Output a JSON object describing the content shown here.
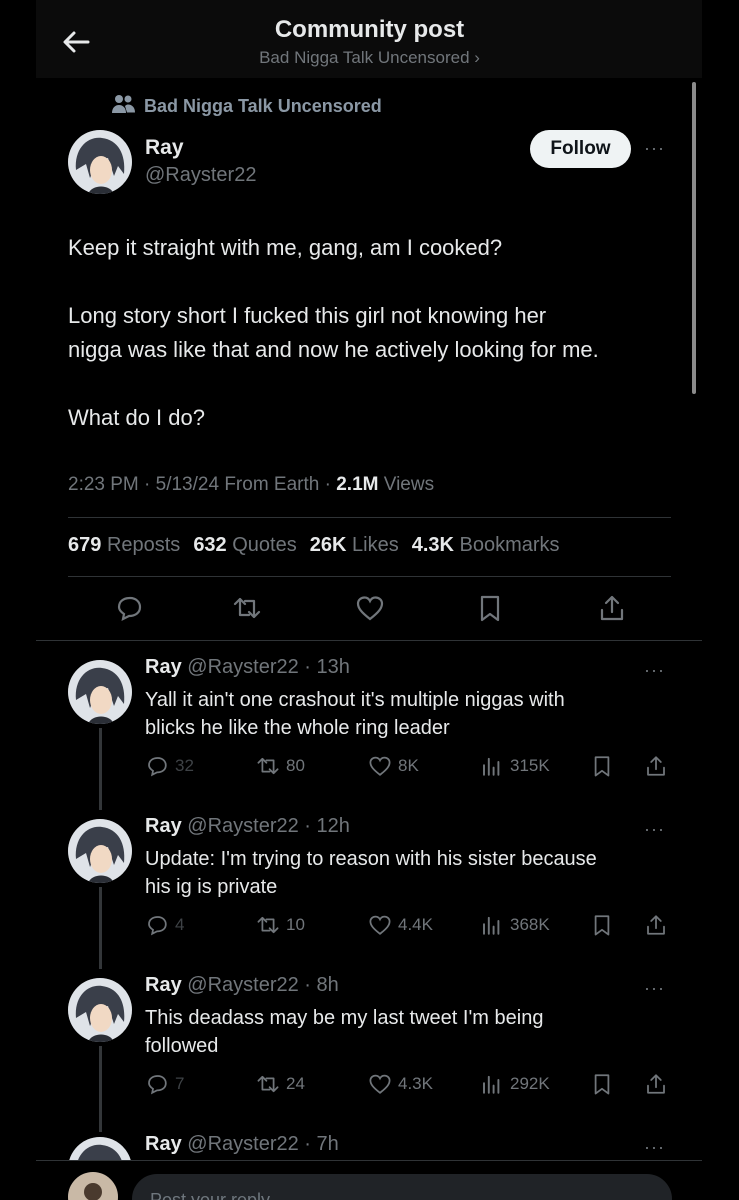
{
  "header": {
    "title": "Community post",
    "subtitle": "Bad Nigga Talk Uncensored ›"
  },
  "community": {
    "name": "Bad Nigga Talk Uncensored"
  },
  "post": {
    "author_name": "Ray",
    "handle": "@Rayster22",
    "follow_label": "Follow",
    "more": "···",
    "para1": "Keep it straight with me, gang, am I cooked?",
    "para2a": "Long story short I fucked this girl not knowing her",
    "para2b": "nigga was like that and now he actively looking for me.",
    "para3": "What do I do?",
    "meta_time": "2:23 PM · 5/13/24 From Earth · ",
    "meta_views_count": "2.1M",
    "meta_views_label": " Views",
    "stats": {
      "reposts_count": "679",
      "reposts_label": "Reposts",
      "quotes_count": "632",
      "quotes_label": "Quotes",
      "likes_count": "26K",
      "likes_label": "Likes",
      "bookmarks_count": "4.3K",
      "bookmarks_label": "Bookmarks"
    }
  },
  "replies": [
    {
      "name": "Ray",
      "handle_time": "@Rayster22 · 13h",
      "line1": "Yall it ain't one crashout it's multiple niggas with",
      "line2": "blicks  he like the whole ring leader",
      "replies": "32",
      "reposts": "80",
      "likes": "8K",
      "views": "315K"
    },
    {
      "name": "Ray",
      "handle_time": "@Rayster22 · 12h",
      "line1": "Update: I'm trying to reason with his sister because",
      "line2": "his ig is private",
      "replies": "4",
      "reposts": "10",
      "likes": "4.4K",
      "views": "368K"
    },
    {
      "name": "Ray",
      "handle_time": "@Rayster22 · 8h",
      "line1": "This deadass may be my last tweet I'm being",
      "line2": "followed",
      "replies": "7",
      "reposts": "24",
      "likes": "4.3K",
      "views": "292K"
    },
    {
      "name": "Ray",
      "handle_time": "@Rayster22 · 7h"
    }
  ],
  "composer": {
    "placeholder": "Post your reply"
  },
  "colors": {
    "background": "#000000",
    "text": "#e7e9ea",
    "muted": "#71767b",
    "divider": "#2f3336"
  }
}
